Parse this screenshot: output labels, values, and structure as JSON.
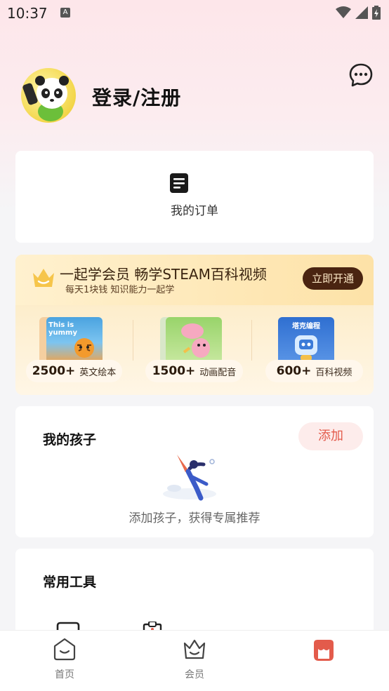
{
  "status_bar": {
    "time": "10:37",
    "indicator": "A"
  },
  "profile": {
    "login_label": "登录/注册"
  },
  "orders": {
    "label": "我的订单"
  },
  "vip": {
    "title": "一起学会员 畅学STEAM百科视频",
    "subtitle": "每天1块钱 知识能力一起学",
    "button_label": "立即开通",
    "items": [
      {
        "count": "2500+",
        "label": "英文绘本",
        "thumb_text": "This is yummy"
      },
      {
        "count": "1500+",
        "label": "动画配音",
        "thumb_text": ""
      },
      {
        "count": "600+",
        "label": "百科视频",
        "thumb_text": "塔克编程"
      }
    ]
  },
  "kids": {
    "title": "我的孩子",
    "add_label": "添加",
    "empty_text": "添加孩子，获得专属推荐"
  },
  "tools": {
    "title": "常用工具"
  },
  "tabbar": {
    "tabs": [
      {
        "label": "首页"
      },
      {
        "label": "会员"
      }
    ]
  },
  "colors": {
    "accent": "#e35b4b",
    "vip_button": "#4a2411",
    "header_bg": "#fde6ea"
  }
}
